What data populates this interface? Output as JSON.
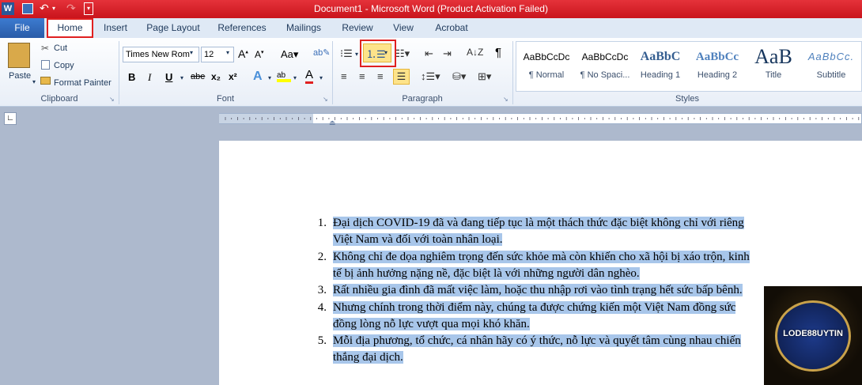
{
  "window": {
    "title": "Document1  -  Microsoft Word (Product Activation Failed)"
  },
  "tabs": [
    "File",
    "Home",
    "Insert",
    "Page Layout",
    "References",
    "Mailings",
    "Review",
    "View",
    "Acrobat"
  ],
  "clipboard": {
    "paste": "Paste",
    "cut": "Cut",
    "copy": "Copy",
    "format_painter": "Format Painter",
    "label": "Clipboard"
  },
  "font": {
    "name": "Times New Rom",
    "size": "12",
    "label": "Font",
    "bold": "B",
    "italic": "I",
    "underline": "U",
    "strike": "abe",
    "sub": "x₂",
    "sup": "x²"
  },
  "paragraph": {
    "label": "Paragraph"
  },
  "styles": {
    "label": "Styles",
    "items": [
      {
        "sample": "AaBbCcDc",
        "name": "¶ Normal"
      },
      {
        "sample": "AaBbCcDc",
        "name": "¶ No Spaci..."
      },
      {
        "sample": "AaBbC",
        "name": "Heading 1"
      },
      {
        "sample": "AaBbCc",
        "name": "Heading 2"
      },
      {
        "sample": "AaB",
        "name": "Title"
      },
      {
        "sample": "AaBbCc.",
        "name": "Subtitle"
      }
    ]
  },
  "document": {
    "items": [
      {
        "num": "1.",
        "lines": [
          "Đại dịch COVID-19 đã và đang tiếp tục là một thách thức đặc biệt không chỉ với riêng",
          "Việt Nam và đối với toàn nhân loại."
        ]
      },
      {
        "num": "2.",
        "lines": [
          "Không chỉ đe dọa nghiêm trọng đến sức khỏe mà còn khiến cho xã hội bị xáo trộn, kinh",
          "tế bị ảnh hưởng nặng nề, đặc biệt là với những người dân nghèo."
        ]
      },
      {
        "num": "3.",
        "lines": [
          "Rất nhiều gia đình đã mất việc làm, hoặc thu nhập rơi vào tình trạng hết sức bấp bênh."
        ]
      },
      {
        "num": "4.",
        "lines": [
          "Nhưng chính trong thời điểm này, chúng ta được chứng kiến một Việt Nam đồng sức",
          "đồng lòng nỗ lực vượt qua mọi khó khăn."
        ]
      },
      {
        "num": "5.",
        "lines": [
          "Mỗi địa phương, tổ chức, cá nhân hãy có ý thức, nỗ lực và quyết tâm cùng nhau chiến",
          "thắng đại dịch."
        ]
      }
    ]
  },
  "logo": {
    "text": "LODE88UYTIN"
  }
}
